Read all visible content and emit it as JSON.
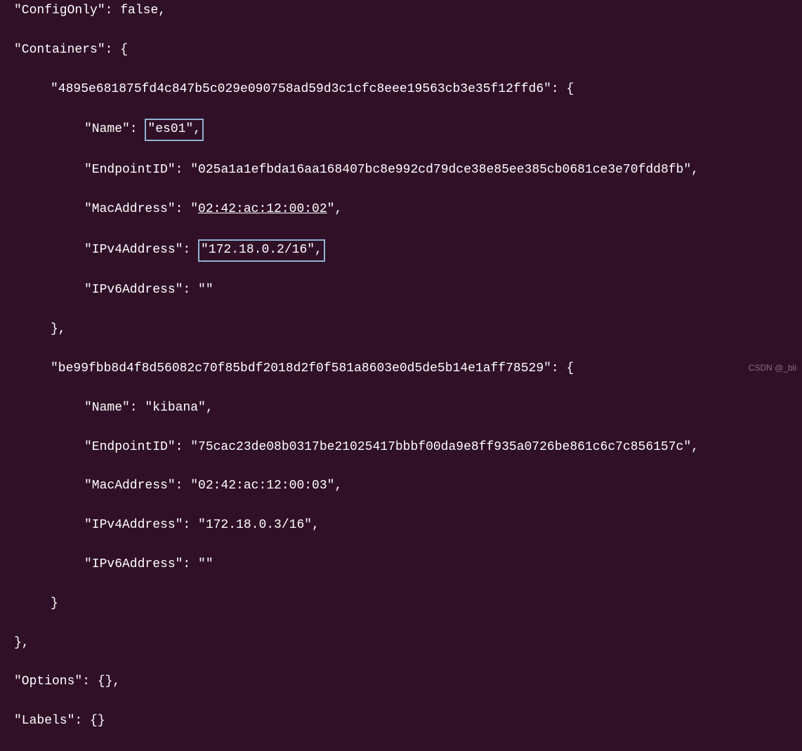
{
  "json": {
    "configOnly_key": "\"ConfigOnly\": ",
    "configOnly_val": "false,",
    "containers_key": "\"Containers\": {",
    "c1_id": "\"4895e681875fd4c847b5c029e090758ad59d3c1cfc8eee19563cb3e35f12ffd6\": {",
    "c1_name_key": "\"Name\": ",
    "c1_name_val": "\"es01\",",
    "c1_endpoint_key": "\"EndpointID\": ",
    "c1_endpoint_val": "\"025a1a1efbda16aa168407bc8e992cd79dce38e85ee385cb0681ce3e70fdd8fb\",",
    "c1_mac_key": "\"MacAddress\": \"",
    "c1_mac_val": "02:42:ac:12:00:02",
    "c1_mac_end": "\",",
    "c1_ipv4_key": "\"IPv4Address\": ",
    "c1_ipv4_val": "\"172.18.0.2/16\",",
    "c1_ipv6": "\"IPv6Address\": \"\"",
    "close_brace_comma": "},",
    "c2_id": "\"be99fbb8d4f8d56082c70f85bdf2018d2f0f581a8603e0d5de5b14e1aff78529\": {",
    "c2_name": "\"Name\": \"kibana\",",
    "c2_endpoint": "\"EndpointID\": \"75cac23de08b0317be21025417bbbf00da9e8ff935a0726be861c6c7c856157c\",",
    "c2_mac": "\"MacAddress\": \"02:42:ac:12:00:03\",",
    "c2_ipv4": "\"IPv4Address\": \"172.18.0.3/16\",",
    "c2_ipv6": "\"IPv6Address\": \"\"",
    "close_brace": "}",
    "options": "\"Options\": {},",
    "labels": "\"Labels\": {}",
    "watermark": "CSDN @_bli"
  }
}
